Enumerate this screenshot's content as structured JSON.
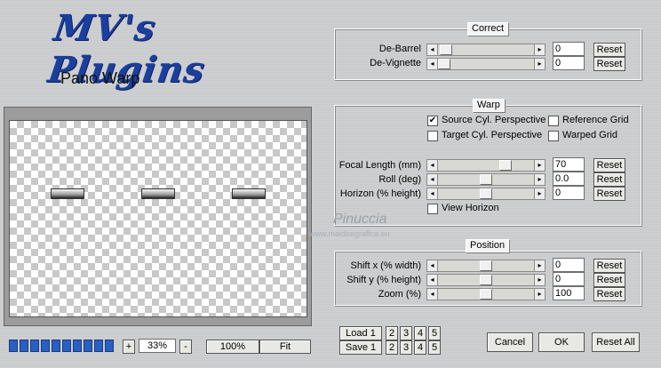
{
  "logo": "MV's Plugins",
  "subtitle": "Pano Warp",
  "correct": {
    "title": "Correct",
    "rows": [
      {
        "label": "De-Barrel",
        "value": "0",
        "reset": "Reset",
        "level": 0.1
      },
      {
        "label": "De-Vignette",
        "value": "0",
        "reset": "Reset",
        "level": 0.05
      }
    ]
  },
  "warp": {
    "title": "Warp",
    "checks": [
      {
        "label": "Source Cyl. Perspective",
        "checked": true
      },
      {
        "label": "Reference Grid",
        "checked": false
      },
      {
        "label": "Target Cyl. Perspective",
        "checked": false
      },
      {
        "label": "Warped Grid",
        "checked": false
      }
    ],
    "rows": [
      {
        "label": "Focal Length (mm)",
        "value": "70",
        "reset": "Reset",
        "level": 0.7
      },
      {
        "label": "Roll (deg)",
        "value": "0.0",
        "reset": "Reset",
        "level": 0.5
      },
      {
        "label": "Horizon (% height)",
        "value": "0",
        "reset": "Reset",
        "level": 0.5
      }
    ],
    "view_horizon": "View Horizon"
  },
  "position": {
    "title": "Position",
    "rows": [
      {
        "label": "Shift x (% width)",
        "value": "0",
        "reset": "Reset",
        "level": 0.5
      },
      {
        "label": "Shift y (% height)",
        "value": "0",
        "reset": "Reset",
        "level": 0.5
      },
      {
        "label": "Zoom (%)",
        "value": "100",
        "reset": "Reset",
        "level": 0.5
      }
    ]
  },
  "zoom": {
    "plus": "+",
    "value": "33%",
    "minus": "-",
    "full": "100%",
    "fit": "Fit"
  },
  "presets": {
    "load": "Load 1",
    "save": "Save 1",
    "slots": [
      "2",
      "3",
      "4",
      "5"
    ]
  },
  "actions": {
    "cancel": "Cancel",
    "ok": "OK",
    "reset_all": "Reset All"
  },
  "watermark": {
    "name": "Pinuccia",
    "site": "www.maidiregrafica.eu"
  }
}
